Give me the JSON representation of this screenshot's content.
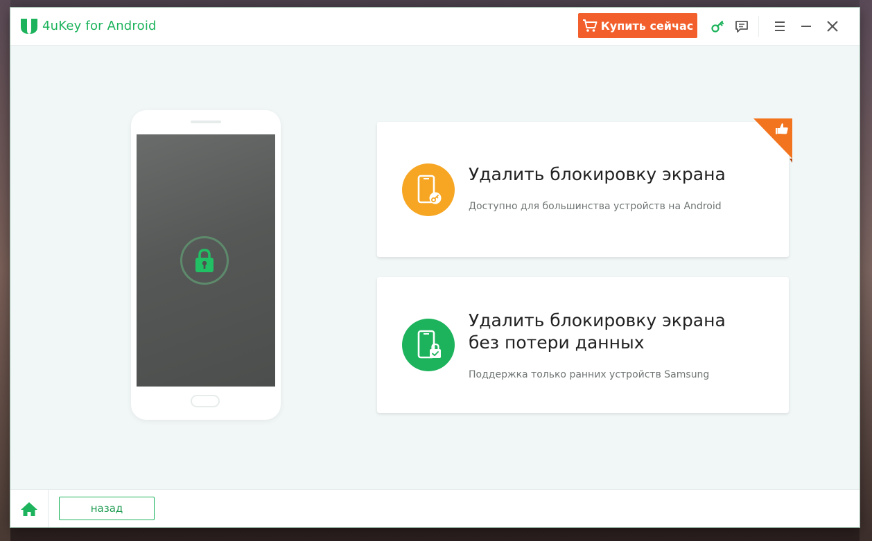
{
  "app": {
    "title": "4uKey for Android",
    "accent_color": "#1db35c",
    "logo_icon": "4ukey-logo-icon"
  },
  "titlebar": {
    "buy_label": "Купить сейчас",
    "buy_color": "#f25f2c",
    "icons": [
      "cart-icon",
      "key-icon",
      "feedback-icon",
      "menu-icon",
      "minimize-icon",
      "close-icon"
    ]
  },
  "phone": {
    "screen_icon": "lock-icon"
  },
  "options": [
    {
      "title": "Удалить блокировку экрана",
      "subtitle": "Доступно для большинства устройств на Android",
      "icon": "phone-key-icon",
      "icon_color": "#f6a623",
      "badge": "thumbs-up-icon",
      "badge_color": "#f2741f"
    },
    {
      "title": "Удалить блокировку экрана без потери данных",
      "subtitle": "Поддержка только ранних устройств Samsung",
      "icon": "phone-lock-icon",
      "icon_color": "#1db35c"
    }
  ],
  "footer": {
    "home_icon": "home-icon",
    "back_label": "назад"
  }
}
